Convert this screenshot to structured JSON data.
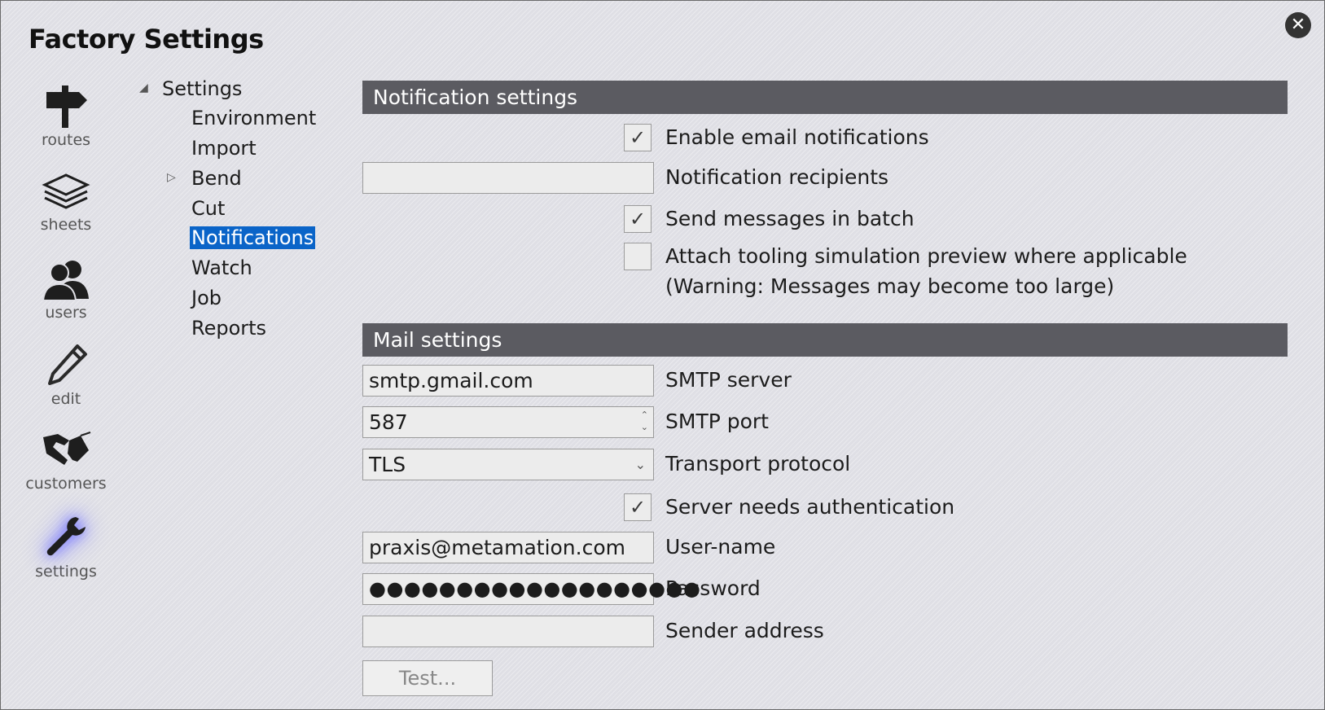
{
  "window": {
    "title": "Factory Settings"
  },
  "rail": {
    "items": [
      {
        "icon": "signpost-icon",
        "label": "routes"
      },
      {
        "icon": "sheets-stack-icon",
        "label": "sheets"
      },
      {
        "icon": "users-icon",
        "label": "users"
      },
      {
        "icon": "pencil-icon",
        "label": "edit"
      },
      {
        "icon": "handshake-icon",
        "label": "customers"
      },
      {
        "icon": "wrench-icon",
        "label": "settings",
        "active": true
      }
    ]
  },
  "tree": {
    "root": "Settings",
    "children": [
      "Environment",
      "Import",
      "Bend",
      "Cut",
      "Notifications",
      "Watch",
      "Job",
      "Reports"
    ],
    "selected": "Notifications",
    "accent": "#0a64c8"
  },
  "notification_settings": {
    "header": "Notification settings",
    "enable_email": {
      "label": "Enable email notifications",
      "checked": true
    },
    "recipients": {
      "label": "Notification recipients",
      "value": ""
    },
    "batch": {
      "label": "Send messages in batch",
      "checked": true
    },
    "attach_preview": {
      "label": "Attach tooling simulation preview where applicable",
      "note": "(Warning: Messages may become too large)",
      "checked": false
    }
  },
  "mail_settings": {
    "header": "Mail settings",
    "smtp_server": {
      "label": "SMTP server",
      "value": "smtp.gmail.com"
    },
    "smtp_port": {
      "label": "SMTP port",
      "value": "587"
    },
    "transport": {
      "label": "Transport protocol",
      "value": "TLS"
    },
    "auth": {
      "label": "Server needs authentication",
      "checked": true
    },
    "username": {
      "label": "User-name",
      "value": "praxis@metamation.com"
    },
    "password": {
      "label": "Password",
      "value": "●●●●●●●●●●●●●●●●●●●"
    },
    "sender": {
      "label": "Sender address",
      "value": ""
    },
    "test_button": "Test..."
  },
  "icons": {
    "check": "✓",
    "close": "✕",
    "spin_up": "⌃",
    "spin_down": "⌄",
    "dropdown": "⌄",
    "expanded": "◢",
    "collapsed": "▷"
  },
  "colors": {
    "header_bg": "#5b5b61",
    "selection": "#0a64c8",
    "glow": "#6c6cff"
  }
}
